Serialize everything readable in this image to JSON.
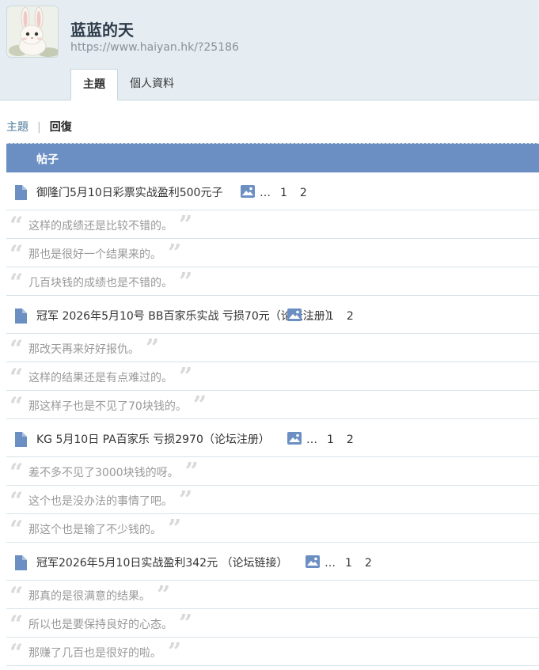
{
  "profile": {
    "name": "蓝蓝的天",
    "url": "https://www.haiyan.hk/?25186"
  },
  "tabs": [
    {
      "label": "主題",
      "active": true
    },
    {
      "label": "個人資料",
      "active": false
    }
  ],
  "subnav": {
    "topics": "主題",
    "separator": "|",
    "replies": "回復"
  },
  "table_header": "帖子",
  "ellipsis": "…",
  "threads": [
    {
      "title": "御隆门5月10日彩票实战盈利500元子",
      "pages": [
        "1",
        "2"
      ],
      "replies": [
        "这样的成绩还是比较不错的。",
        "那也是很好一个结果来的。",
        "几百块钱的成绩也是不错的。"
      ]
    },
    {
      "title": "冠军 2026年5月10号 BB百家乐实战 亏损70元（论坛注册）",
      "pages": [
        "1",
        "2"
      ],
      "replies": [
        "那改天再来好好报仇。",
        "这样的结果还是有点难过的。",
        "那这样子也是不见了70块钱的。"
      ]
    },
    {
      "title": "KG 5月10日 PA百家乐 亏损2970（论坛注册）",
      "pages": [
        "1",
        "2"
      ],
      "replies": [
        "差不多不见了3000块钱的呀。",
        "这个也是没办法的事情了吧。",
        "那这个也是输了不少钱的。"
      ]
    },
    {
      "title": "冠军2026年5月10日实战盈利342元 （论坛链接）",
      "pages": [
        "1",
        "2"
      ],
      "replies": [
        "那真的是很满意的结果。",
        "所以也是要保持良好的心态。",
        "那赚了几百也是很好的啦。"
      ]
    }
  ],
  "colors": {
    "header_bg": "#e5edf2",
    "table_header_bg": "#6b8fc3",
    "icon": "#6b8fc3",
    "link": "#4e7c9d"
  },
  "icons": {
    "thread": "document-icon",
    "attachment": "image-icon",
    "quote_open": "quote-open-icon",
    "quote_close": "quote-close-icon"
  }
}
